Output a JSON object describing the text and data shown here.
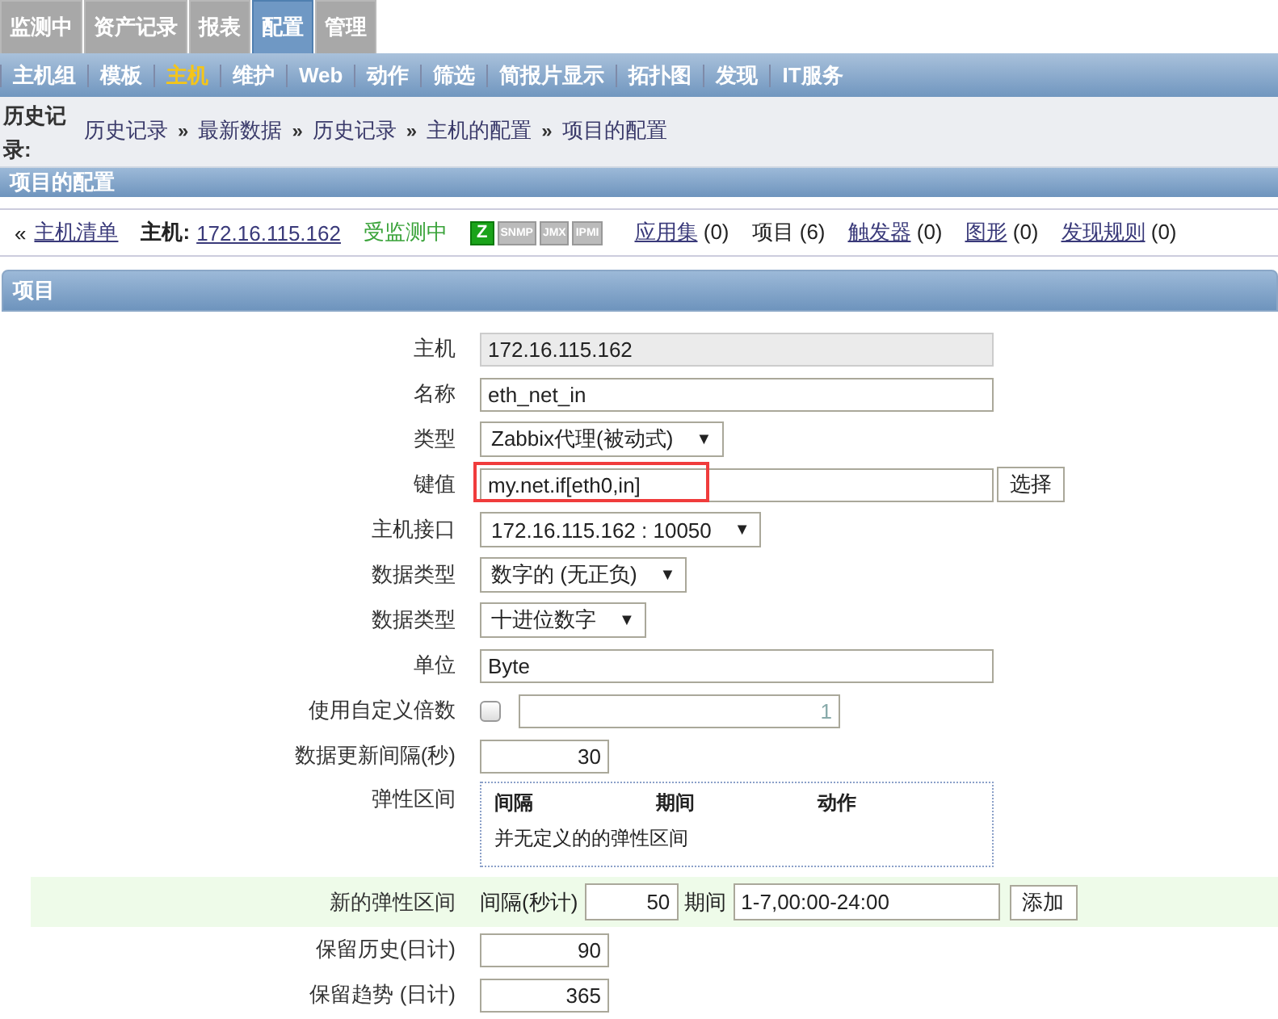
{
  "main_menu": [
    {
      "label": "监测中",
      "selected": false
    },
    {
      "label": "资产记录",
      "selected": false
    },
    {
      "label": "报表",
      "selected": false
    },
    {
      "label": "配置",
      "selected": true
    },
    {
      "label": "管理",
      "selected": false
    }
  ],
  "sub_menu": [
    {
      "label": "主机组",
      "selected": false
    },
    {
      "label": "模板",
      "selected": false
    },
    {
      "label": "主机",
      "selected": true
    },
    {
      "label": "维护",
      "selected": false
    },
    {
      "label": "Web",
      "selected": false
    },
    {
      "label": "动作",
      "selected": false
    },
    {
      "label": "筛选",
      "selected": false
    },
    {
      "label": "简报片显示",
      "selected": false
    },
    {
      "label": "拓扑图",
      "selected": false
    },
    {
      "label": "发现",
      "selected": false
    },
    {
      "label": "IT服务",
      "selected": false
    }
  ],
  "breadcrumb": {
    "label": "历史记录:",
    "items": [
      {
        "label": "历史记录"
      },
      {
        "separator": "»",
        "label": "最新数据"
      },
      {
        "separator": "»",
        "label": "历史记录"
      },
      {
        "separator": "»",
        "label": "主机的配置"
      },
      {
        "separator": "»",
        "label": "项目的配置"
      }
    ]
  },
  "page_title": "项目的配置",
  "host_bar": {
    "back": "«",
    "list_link": "主机清单",
    "host_label": "主机:",
    "host": "172.16.115.162",
    "status": "受监测中",
    "badges": [
      {
        "label": "Z",
        "on": true
      },
      {
        "label": "SNMP",
        "on": false
      },
      {
        "label": "JMX",
        "on": false
      },
      {
        "label": "IPMI",
        "on": false
      }
    ],
    "links": [
      {
        "label": "应用集",
        "count": "(0)",
        "link": true
      },
      {
        "label": "项目",
        "count": "(6)",
        "link": false
      },
      {
        "label": "触发器",
        "count": "(0)",
        "link": true
      },
      {
        "label": "图形",
        "count": "(0)",
        "link": true
      },
      {
        "label": "发现规则",
        "count": "(0)",
        "link": true
      }
    ]
  },
  "section_title": "项目",
  "form": [
    {
      "kind": "readonly",
      "label": "主机",
      "value": "172.16.115.162"
    },
    {
      "kind": "text",
      "label": "名称",
      "value": "eth_net_in"
    },
    {
      "kind": "select",
      "label": "类型",
      "value": "Zabbix代理(被动式)",
      "arrow": "▼"
    },
    {
      "kind": "text",
      "label": "键值",
      "value": "my.net.if[eth0,in]",
      "highlighted": true,
      "button": "选择"
    },
    {
      "kind": "select",
      "label": "主机接口",
      "value": "172.16.115.162 : 10050",
      "arrow": "▼"
    },
    {
      "kind": "select",
      "label": "数据类型",
      "value": "数字的 (无正负)",
      "arrow": "▼"
    },
    {
      "kind": "select",
      "label": "数据类型",
      "value": "十进位数字",
      "arrow": "▼"
    },
    {
      "kind": "text",
      "label": "单位",
      "value": "Byte"
    },
    {
      "kind": "checkbox",
      "label": "使用自定义倍数",
      "checked": false,
      "value": "1"
    },
    {
      "kind": "number",
      "label": "数据更新间隔(秒)",
      "value": "30"
    },
    {
      "kind": "table",
      "label": "弹性区间",
      "columns": [
        "间隔",
        "期间",
        "动作"
      ],
      "empty": "并无定义的的弹性区间"
    },
    {
      "kind": "new_interval",
      "label": "新的弹性区间",
      "interval_label": "间隔(秒计)",
      "interval": "50",
      "period_label": "期间",
      "period": "1-7,00:00-24:00",
      "button": "添加"
    },
    {
      "kind": "number",
      "label": "保留历史(日计)",
      "value": "90"
    },
    {
      "kind": "number",
      "label": "保留趋势 (日计)",
      "value": "365"
    }
  ]
}
